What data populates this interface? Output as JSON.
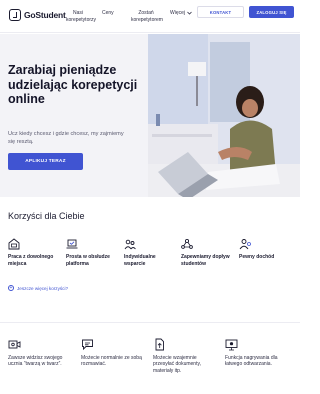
{
  "header": {
    "brand": "GoStudent",
    "nav": [
      {
        "label": "Nasi korepetytorzy"
      },
      {
        "label": "Ceny"
      },
      {
        "label": "Zostań korepetytorem"
      },
      {
        "label": "Więcej"
      }
    ],
    "contact_label": "KONTAKT",
    "login_label": "ZALOGUJ SIĘ"
  },
  "hero": {
    "title": "Zarabiaj pieniądze udzielając korepetycji online",
    "subtitle": "Ucz kiedy chcesz i gdzie chcesz, my zajmiemy się resztą.",
    "cta_label": "APLIKUJ TERAZ"
  },
  "benefits": {
    "title": "Korzyści dla Ciebie",
    "items": [
      {
        "label": "Praca z dowolnego miejsca",
        "icon": "home-office-icon"
      },
      {
        "label": "Prosta w obsłudze platforma",
        "icon": "laptop-check-icon"
      },
      {
        "label": "Indywidualne wsparcie",
        "icon": "support-people-icon"
      },
      {
        "label": "Zapewniamy dopływ studentów",
        "icon": "students-network-icon"
      },
      {
        "label": "Pewny dochód",
        "icon": "money-person-icon"
      }
    ],
    "more_label": "Jeszcze więcej korzyści?"
  },
  "features": [
    {
      "label": "Zawsze widzisz swojego ucznia “twarzą w twarz”.",
      "icon": "video-call-icon"
    },
    {
      "label": "Możecie normalnie ze sobą rozmawiać.",
      "icon": "chat-icon"
    },
    {
      "label": "Możecie wzajemnie przesyłać dokumenty, materiały itp.",
      "icon": "document-upload-icon"
    },
    {
      "label": "Funkcja nagrywania dla łatwego odtwarzania.",
      "icon": "screen-record-icon"
    }
  ],
  "colors": {
    "accent": "#4054d2",
    "text": "#1b1b2f",
    "hero_bg": "#f3f3f7"
  }
}
